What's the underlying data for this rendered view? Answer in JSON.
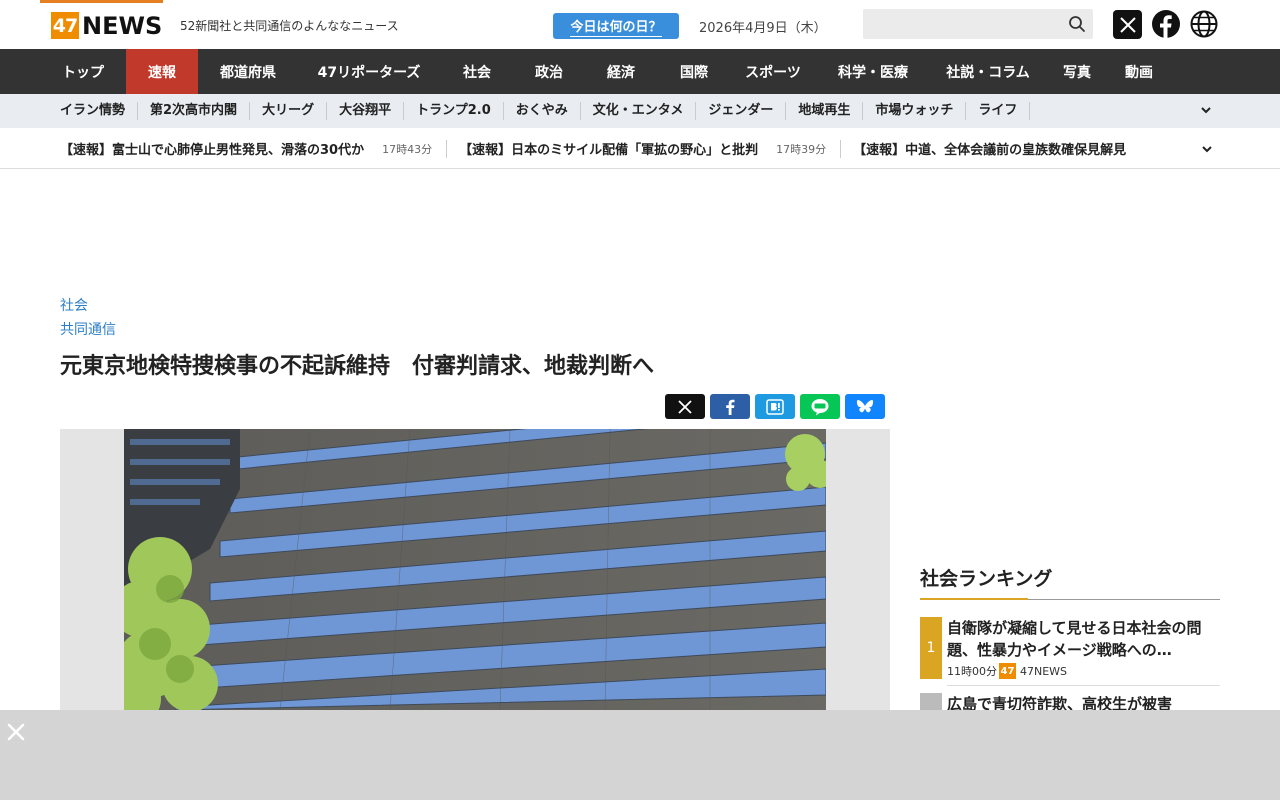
{
  "header": {
    "logo_num": "47",
    "logo_word": "NEWS",
    "tagline": "52新聞社と共同通信のよんななニュース",
    "today_button": "今日は何の日？",
    "date": "2026年4月9日（木）",
    "search_placeholder": ""
  },
  "main_nav": [
    {
      "label": "トップ"
    },
    {
      "label": "速報"
    },
    {
      "label": "都道府県"
    },
    {
      "label": "47リポーターズ"
    },
    {
      "label": "社会"
    },
    {
      "label": "政治"
    },
    {
      "label": "経済"
    },
    {
      "label": "国際"
    },
    {
      "label": "スポーツ"
    },
    {
      "label": "科学・医療"
    },
    {
      "label": "社説・コラム"
    },
    {
      "label": "写真"
    },
    {
      "label": "動画"
    }
  ],
  "sub_nav": [
    {
      "label": "イラン情勢"
    },
    {
      "label": "第2次高市内閣"
    },
    {
      "label": "大リーグ"
    },
    {
      "label": "大谷翔平"
    },
    {
      "label": "トランプ2.0"
    },
    {
      "label": "おくやみ"
    },
    {
      "label": "文化・エンタメ"
    },
    {
      "label": "ジェンダー"
    },
    {
      "label": "地域再生"
    },
    {
      "label": "市場ウォッチ"
    },
    {
      "label": "ライフ"
    }
  ],
  "ticker": [
    {
      "title": "【速報】富士山で心肺停止男性発見、滑落の30代か",
      "time": "17時43分"
    },
    {
      "title": "【速報】日本のミサイル配備「軍拡の野心」と批判",
      "time": "17時39分"
    },
    {
      "title": "【速報】中道、全体会議前の皇族数確保見解見",
      "time": ""
    }
  ],
  "article": {
    "category": "社会",
    "source": "共同通信",
    "headline": "元東京地検特捜検事の不起訴維持　付審判請求、地裁判断へ"
  },
  "ranking": {
    "title": "社会ランキング",
    "items": [
      {
        "rank": "1",
        "text": "自衛隊が凝縮して見せる日本社会の問題、性暴力やイメージ戦略への…",
        "time": "11時00分",
        "badge": "47",
        "source": "47NEWS"
      },
      {
        "rank": "",
        "text": "広島で青切符詐欺、高校生が被害",
        "time": "",
        "badge": "",
        "source": ""
      }
    ]
  }
}
